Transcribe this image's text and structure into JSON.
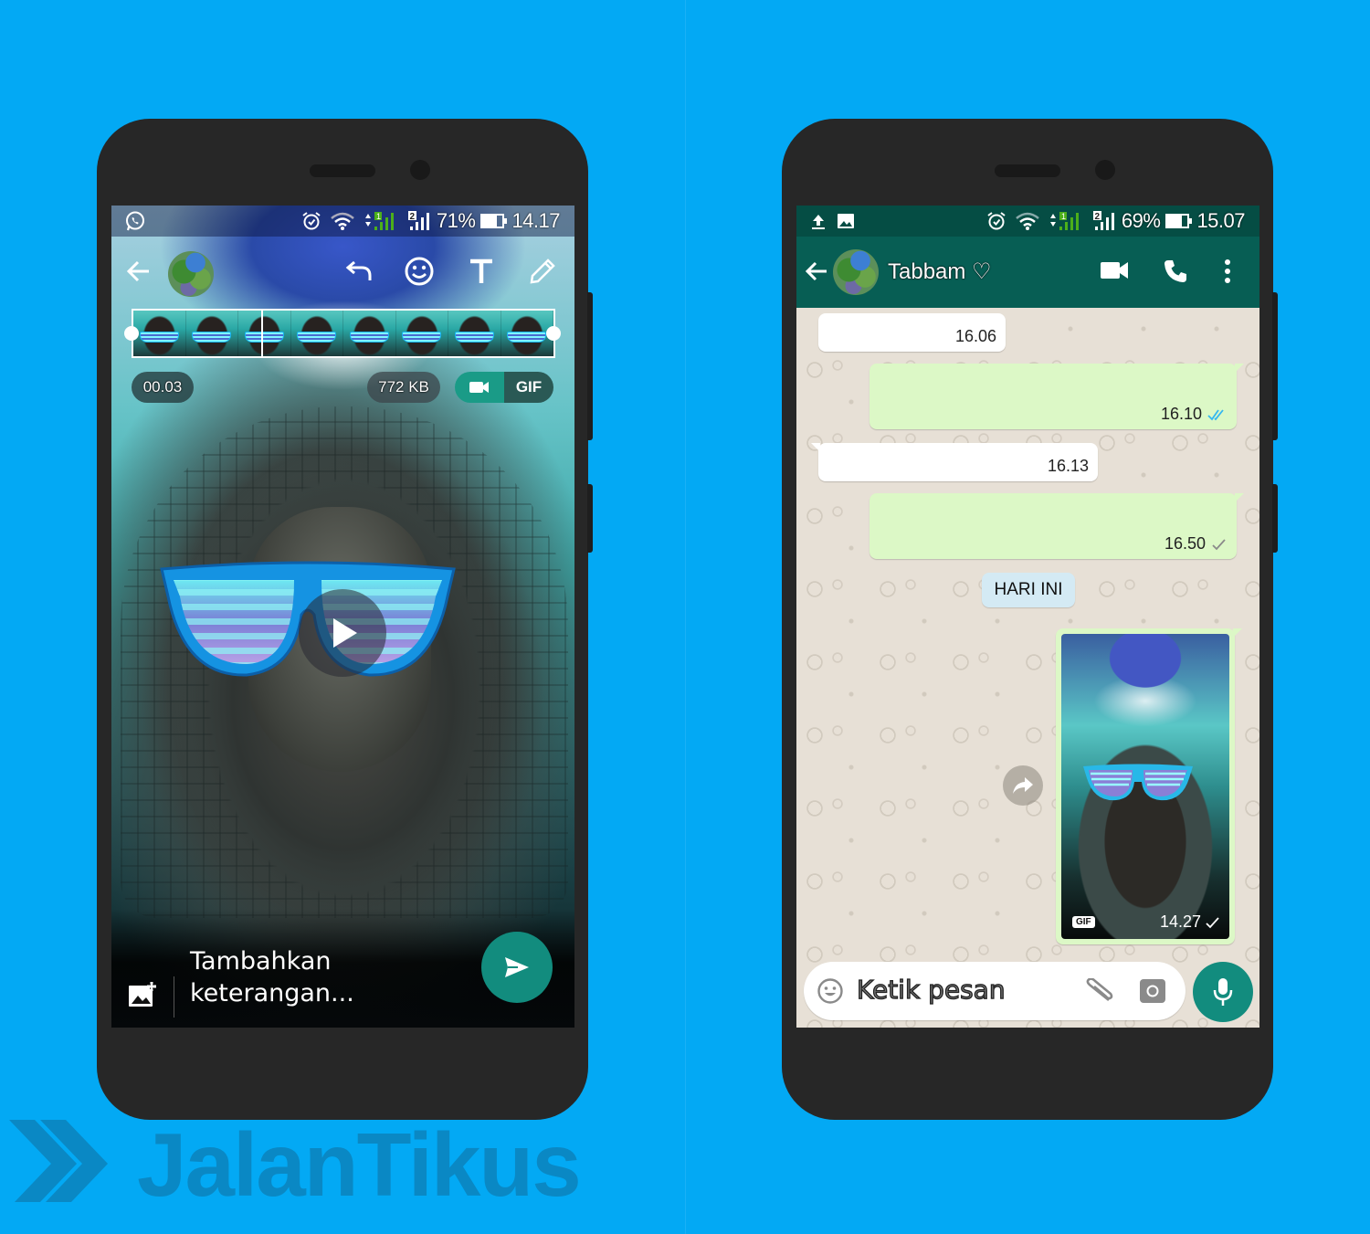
{
  "colors": {
    "background": "#03a9f4",
    "phone_body": "#272727",
    "whatsapp_teal_dark": "#075e54",
    "whatsapp_status_bar": "#054d44",
    "whatsapp_fab": "#128c7e",
    "outgoing_bubble": "#dcf8c6",
    "incoming_bubble": "#ffffff",
    "date_chip": "#d4eaf4",
    "read_ticks_blue": "#34b7f1",
    "watermark": "#0a88c4"
  },
  "left_phone": {
    "status_bar": {
      "left_icon": "whatsapp-icon",
      "icons": [
        "alarm-icon",
        "wifi-icon",
        "data-arrows-icon",
        "sim1-signal-icon",
        "sim2-signal-icon"
      ],
      "battery_percent": "71%",
      "battery_level": 0.71,
      "time": "14.17"
    },
    "toolbar": {
      "back_icon": "arrow-back-icon",
      "avatar": "contact-avatar",
      "actions": [
        "undo-icon",
        "emoji-icon",
        "text-icon",
        "pencil-icon"
      ]
    },
    "trimmer": {
      "frame_count": 8,
      "cursor_position": 0.31
    },
    "duration": "00.03",
    "file_size": "772 KB",
    "mode_toggle": {
      "video_icon": "videocam-icon",
      "gif_label": "GIF",
      "selected": "GIF"
    },
    "play_icon": "play-icon",
    "caption_placeholder_line1": "Tambahkan",
    "caption_placeholder_line2": "keterangan...",
    "caption_placeholder": "Tambahkan keterangan...",
    "add_image_icon": "add-photo-icon",
    "send_icon": "send-icon"
  },
  "right_phone": {
    "status_bar": {
      "left_icons": [
        "upload-icon",
        "image-icon"
      ],
      "icons": [
        "alarm-icon",
        "wifi-icon",
        "data-arrows-icon",
        "sim1-signal-icon",
        "sim2-signal-icon"
      ],
      "battery_percent": "69%",
      "battery_level": 0.69,
      "time": "15.07"
    },
    "app_bar": {
      "contact_name": "Tabbam ♡",
      "actions": [
        "videocam-icon",
        "phone-icon",
        "more-vert-icon"
      ]
    },
    "messages": [
      {
        "direction": "incoming",
        "time": "16.06",
        "status": ""
      },
      {
        "direction": "outgoing",
        "time": "16.10",
        "status": "read"
      },
      {
        "direction": "incoming",
        "time": "16.13",
        "status": ""
      },
      {
        "direction": "outgoing",
        "time": "16.50",
        "status": "sent"
      }
    ],
    "date_separator": "HARI INI",
    "media_message": {
      "badge": "GIF",
      "time": "14.27",
      "status": "sent"
    },
    "input": {
      "placeholder": "Ketik pesan",
      "emoji_icon": "emoji-icon",
      "attach_icon": "attach-icon",
      "camera_icon": "camera-icon",
      "mic_icon": "mic-icon"
    }
  },
  "watermark": {
    "text": "JalanTikus"
  }
}
